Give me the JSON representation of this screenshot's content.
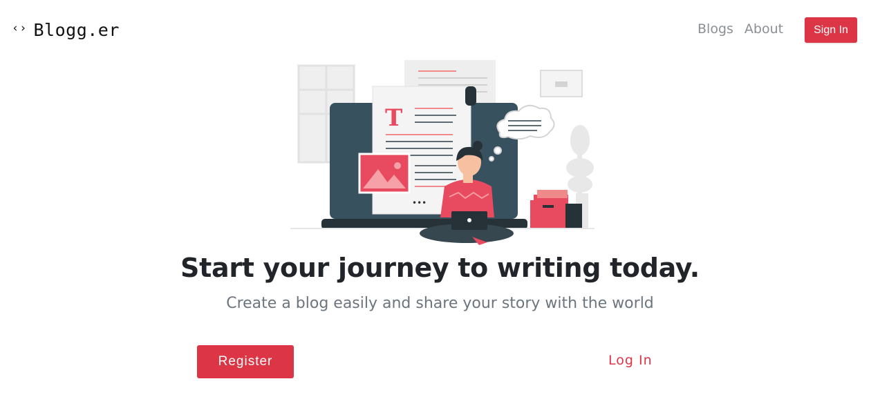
{
  "navbar": {
    "brand_icon": "‹›",
    "brand_text": "Blogg.er",
    "links": [
      "Blogs",
      "About"
    ],
    "signin_label": "Sign In"
  },
  "hero": {
    "headline_strong": "Start",
    "headline_rest": " your journey to writing today.",
    "subtitle": "Create a blog easily and share your story with the world",
    "illustration_letter": "T",
    "register_label": "Register",
    "login_label": "Log In"
  },
  "colors": {
    "accent": "#dc3545",
    "text": "#212529",
    "muted": "#6c757d",
    "laptop": "#37515f"
  }
}
